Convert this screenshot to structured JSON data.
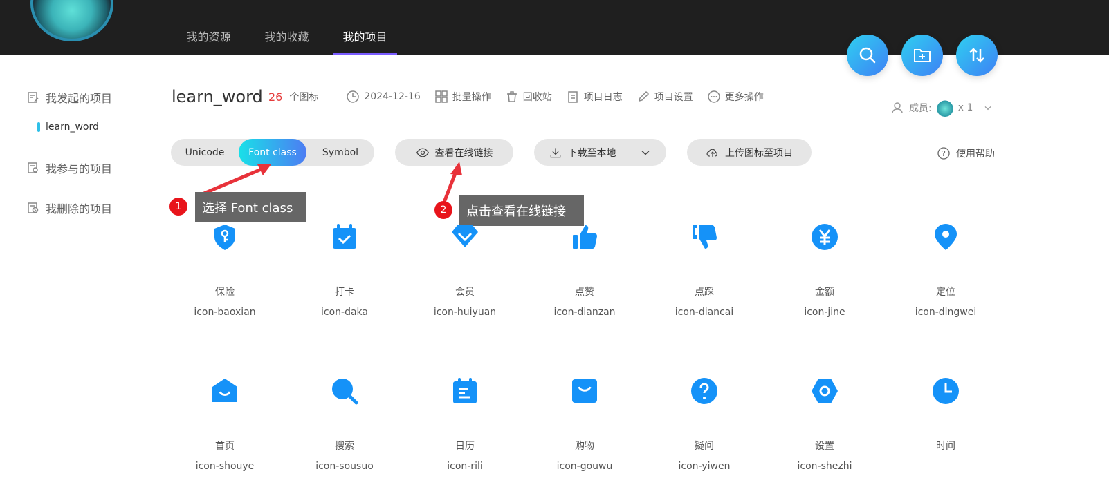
{
  "nav": {
    "items": [
      "我的资源",
      "我的收藏",
      "我的项目"
    ],
    "active_index": 2
  },
  "sidebar": {
    "started": "我发起的项目",
    "current_project": "learn_word",
    "joined": "我参与的项目",
    "deleted": "我删除的项目"
  },
  "project": {
    "title": "learn_word",
    "icon_count": "26",
    "icon_count_label": "个图标",
    "date": "2024-12-16",
    "batch": "批量操作",
    "recycle": "回收站",
    "log": "项目日志",
    "settings": "项目设置",
    "more": "更多操作",
    "members_label": "成员:",
    "members_count": "x 1"
  },
  "toolbar": {
    "tabs": [
      "Unicode",
      "Font class",
      "Symbol"
    ],
    "active_tab": "Font class",
    "view_link": "查看在线链接",
    "download": "下载至本地",
    "upload": "上传图标至项目",
    "help": "使用帮助"
  },
  "annotations": [
    {
      "number": "1",
      "text": "选择 Font class"
    },
    {
      "number": "2",
      "text": "点击查看在线链接"
    }
  ],
  "icons": [
    {
      "cn": "保险",
      "code": "icon-baoxian"
    },
    {
      "cn": "打卡",
      "code": "icon-daka"
    },
    {
      "cn": "会员",
      "code": "icon-huiyuan"
    },
    {
      "cn": "点赞",
      "code": "icon-dianzan"
    },
    {
      "cn": "点踩",
      "code": "icon-diancai"
    },
    {
      "cn": "金额",
      "code": "icon-jine"
    },
    {
      "cn": "定位",
      "code": "icon-dingwei"
    },
    {
      "cn": "首页",
      "code": "icon-shouye"
    },
    {
      "cn": "搜索",
      "code": "icon-sousuo"
    },
    {
      "cn": "日历",
      "code": "icon-rili"
    },
    {
      "cn": "购物",
      "code": "icon-gouwu"
    },
    {
      "cn": "疑问",
      "code": "icon-yiwen"
    },
    {
      "cn": "设置",
      "code": "icon-shezhi"
    },
    {
      "cn": "时间",
      "code": ""
    }
  ],
  "colors": {
    "icon_blue": "#1592f8",
    "accent_gradient_start": "#19e0e8",
    "accent_gradient_end": "#4d7cf3",
    "annotation_red": "#e8141b",
    "icon_count_red": "#e53b3b"
  }
}
